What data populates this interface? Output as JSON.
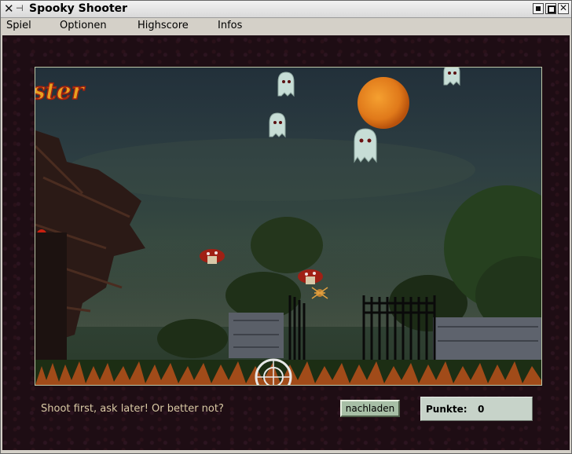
{
  "window": {
    "title": "Spooky Shooter"
  },
  "menu": {
    "items": [
      "Spiel",
      "Optionen",
      "Highscore",
      "Infos"
    ]
  },
  "game": {
    "logo_text": "ster"
  },
  "footer": {
    "status_text": "Shoot first, ask later! Or better not?",
    "reload_label": "nachladen",
    "score_label": "Punkte:",
    "score_value": "0"
  },
  "colors": {
    "frame": "#1e0d14",
    "status_text": "#d8c9a4",
    "button": "#a7bfa6",
    "score_panel": "#c7d3c9",
    "moon": "#e0791a"
  }
}
